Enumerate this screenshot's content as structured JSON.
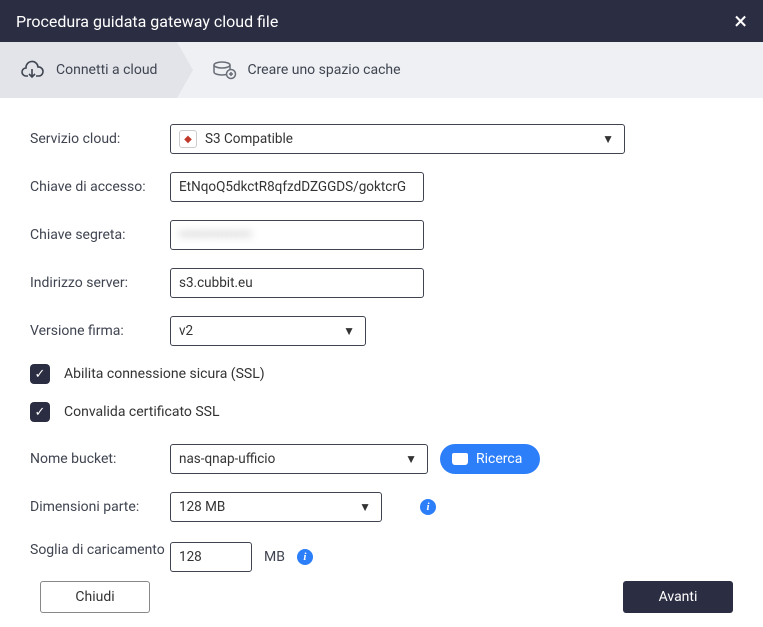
{
  "titlebar": {
    "title": "Procedura guidata gateway cloud file"
  },
  "steps": {
    "step1": "Connetti a cloud",
    "step2": "Creare uno spazio cache"
  },
  "form": {
    "cloud_service": {
      "label": "Servizio cloud:",
      "value": "S3 Compatible"
    },
    "access_key": {
      "label": "Chiave di accesso:",
      "value": "EtNqoQ5dkctR8qfzdDZGGDS/goktcrG"
    },
    "secret_key": {
      "label": "Chiave segreta:",
      "value": "••••••••••••••••"
    },
    "server": {
      "label": "Indirizzo server:",
      "value": "s3.cubbit.eu"
    },
    "sig_version": {
      "label": "Versione firma:",
      "value": "v2"
    },
    "ssl_enable": {
      "label": "Abilita connessione sicura (SSL)"
    },
    "ssl_validate": {
      "label": "Convalida certificato SSL"
    },
    "bucket": {
      "label": "Nome bucket:",
      "value": "nas-qnap-ufficio",
      "search": "Ricerca"
    },
    "part_size": {
      "label": "Dimensioni parte:",
      "value": "128 MB"
    },
    "threshold": {
      "label": "Soglia di caricamento",
      "value": "128",
      "unit": "MB"
    }
  },
  "footer": {
    "close": "Chiudi",
    "next": "Avanti"
  }
}
